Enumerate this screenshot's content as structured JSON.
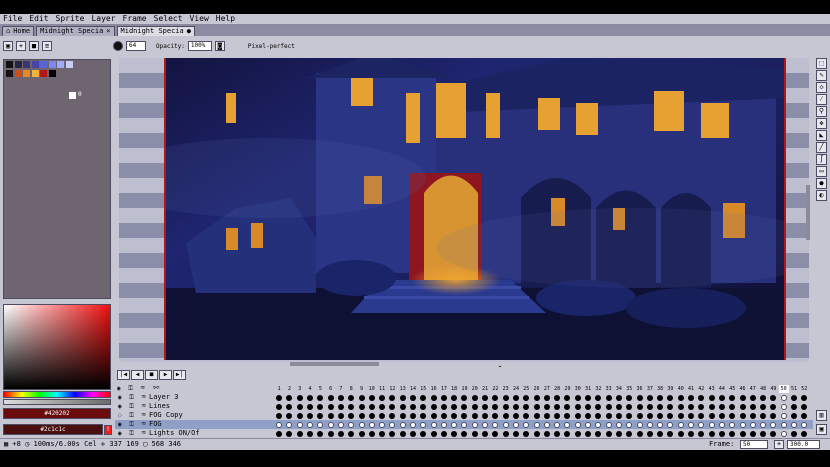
{
  "menu": [
    "File",
    "Edit",
    "Sprite",
    "Layer",
    "Frame",
    "Select",
    "View",
    "Help"
  ],
  "tabs": [
    {
      "label": "Home",
      "close": ""
    },
    {
      "label": "Midnight Specia",
      "close": "×"
    },
    {
      "label": "Midnight Specia",
      "close": "●"
    }
  ],
  "toolbar": {
    "brush_size": "64",
    "opacity_label": "Opacity:",
    "opacity_value": "100%",
    "pixel_perfect": "Pixel-perfect"
  },
  "palette": {
    "row1": [
      "#111111",
      "#2a2540",
      "#393670",
      "#4646a6",
      "#5864d2",
      "#7b86ee",
      "#9faaf5",
      "#c9ccf6"
    ],
    "row2": [
      "#1a1010",
      "#d04c14",
      "#e38a22",
      "#f1b33a",
      "#b11717",
      "#000000"
    ],
    "white_swatch_label": "0"
  },
  "colors": {
    "foreground_hex": "#420202",
    "background_hex": "#2c1c1c",
    "foreground": "#6a0c0c",
    "background": "#4a1010"
  },
  "playback": [
    "|◀",
    "◀",
    "■",
    "▶",
    "▶|"
  ],
  "frames": [
    "1",
    "2",
    "3",
    "4",
    "5",
    "6",
    "7",
    "8",
    "9",
    "10",
    "11",
    "12",
    "13",
    "14",
    "15",
    "16",
    "17",
    "18",
    "19",
    "20",
    "21",
    "22",
    "23",
    "24",
    "25",
    "26",
    "27",
    "28",
    "29",
    "30",
    "31",
    "32",
    "33",
    "34",
    "35",
    "36",
    "37",
    "38",
    "39",
    "40",
    "41",
    "42",
    "43",
    "44",
    "45",
    "46",
    "47",
    "48",
    "49",
    "50",
    "51",
    "52"
  ],
  "layers": [
    {
      "name": "Layer 3",
      "cells": "filled"
    },
    {
      "name": "Lines",
      "cells": "filled"
    },
    {
      "name": "FOG Copy",
      "cells": "filled"
    },
    {
      "name": "FOG",
      "cells": "empty"
    },
    {
      "name": "Lights ON/Of",
      "cells": "filled"
    }
  ],
  "status": {
    "left": "▦ +8  ◷ 100ms/6.00s Cel  ✛ 337 169  ▢ 568 346",
    "frame_label": "Frame:",
    "frame_value": "50",
    "zoom_value": "300.0"
  },
  "right_tools": [
    "rectangle-select-icon",
    "pencil-icon",
    "eraser-icon",
    "eyedropper-icon",
    "zoom-icon",
    "move-icon",
    "bucket-icon",
    "line-icon",
    "curve-icon",
    "rectangle-icon",
    "ellipse-icon",
    "contour-icon",
    "blur-icon"
  ]
}
